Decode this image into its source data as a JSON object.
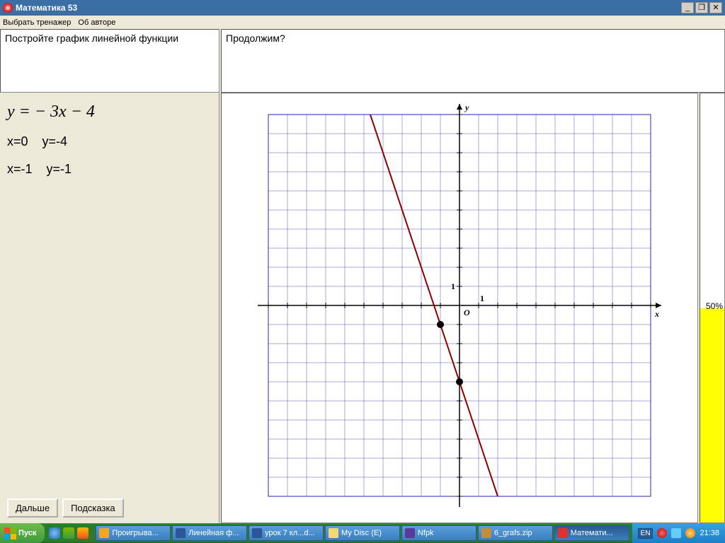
{
  "window": {
    "title": "Математика 53"
  },
  "menu": {
    "item1": "Выбрать тренажер",
    "item2": "Об авторе"
  },
  "panes": {
    "question": "Постройте график линейной функции",
    "prompt": "Продолжим?"
  },
  "left": {
    "equation": "y = − 3x − 4",
    "point1": "x=0    y=-4",
    "point2": "x=-1    y=-1",
    "btn_next": "Дальше",
    "btn_hint": "Подсказка"
  },
  "progress": {
    "percent": 50,
    "label": "50%"
  },
  "chart_data": {
    "type": "line",
    "title": "",
    "xlabel": "x",
    "ylabel": "y",
    "xlim": [
      -10,
      10
    ],
    "ylim": [
      -10,
      10
    ],
    "grid": true,
    "unit_ticks": {
      "x_label": "1",
      "y_label": "1",
      "origin": "O"
    },
    "axis_end_labels": {
      "x": "x",
      "y": "y"
    },
    "series": [
      {
        "name": "y = -3x - 4",
        "x": [
          -4.667,
          2
        ],
        "y": [
          10,
          -10
        ],
        "color": "#8b0000"
      }
    ],
    "marked_points": [
      {
        "x": -1,
        "y": -1
      },
      {
        "x": 0,
        "y": -4
      }
    ]
  },
  "taskbar": {
    "start": "Пуск",
    "items": [
      {
        "label": "Проигрыва...",
        "icon": "#f5a623"
      },
      {
        "label": "Линейная ф...",
        "icon": "#2b579a"
      },
      {
        "label": "урок 7 кл...d...",
        "icon": "#2b579a"
      },
      {
        "label": "My Disc (E)",
        "icon": "#f5d77a"
      },
      {
        "label": "Nfpk",
        "icon": "#5b3a9c"
      },
      {
        "label": "6_grafs.zip",
        "icon": "#c28e3a"
      },
      {
        "label": "Математи...",
        "icon": "#e03030",
        "active": true
      }
    ],
    "lang": "EN",
    "time": "21:38"
  }
}
